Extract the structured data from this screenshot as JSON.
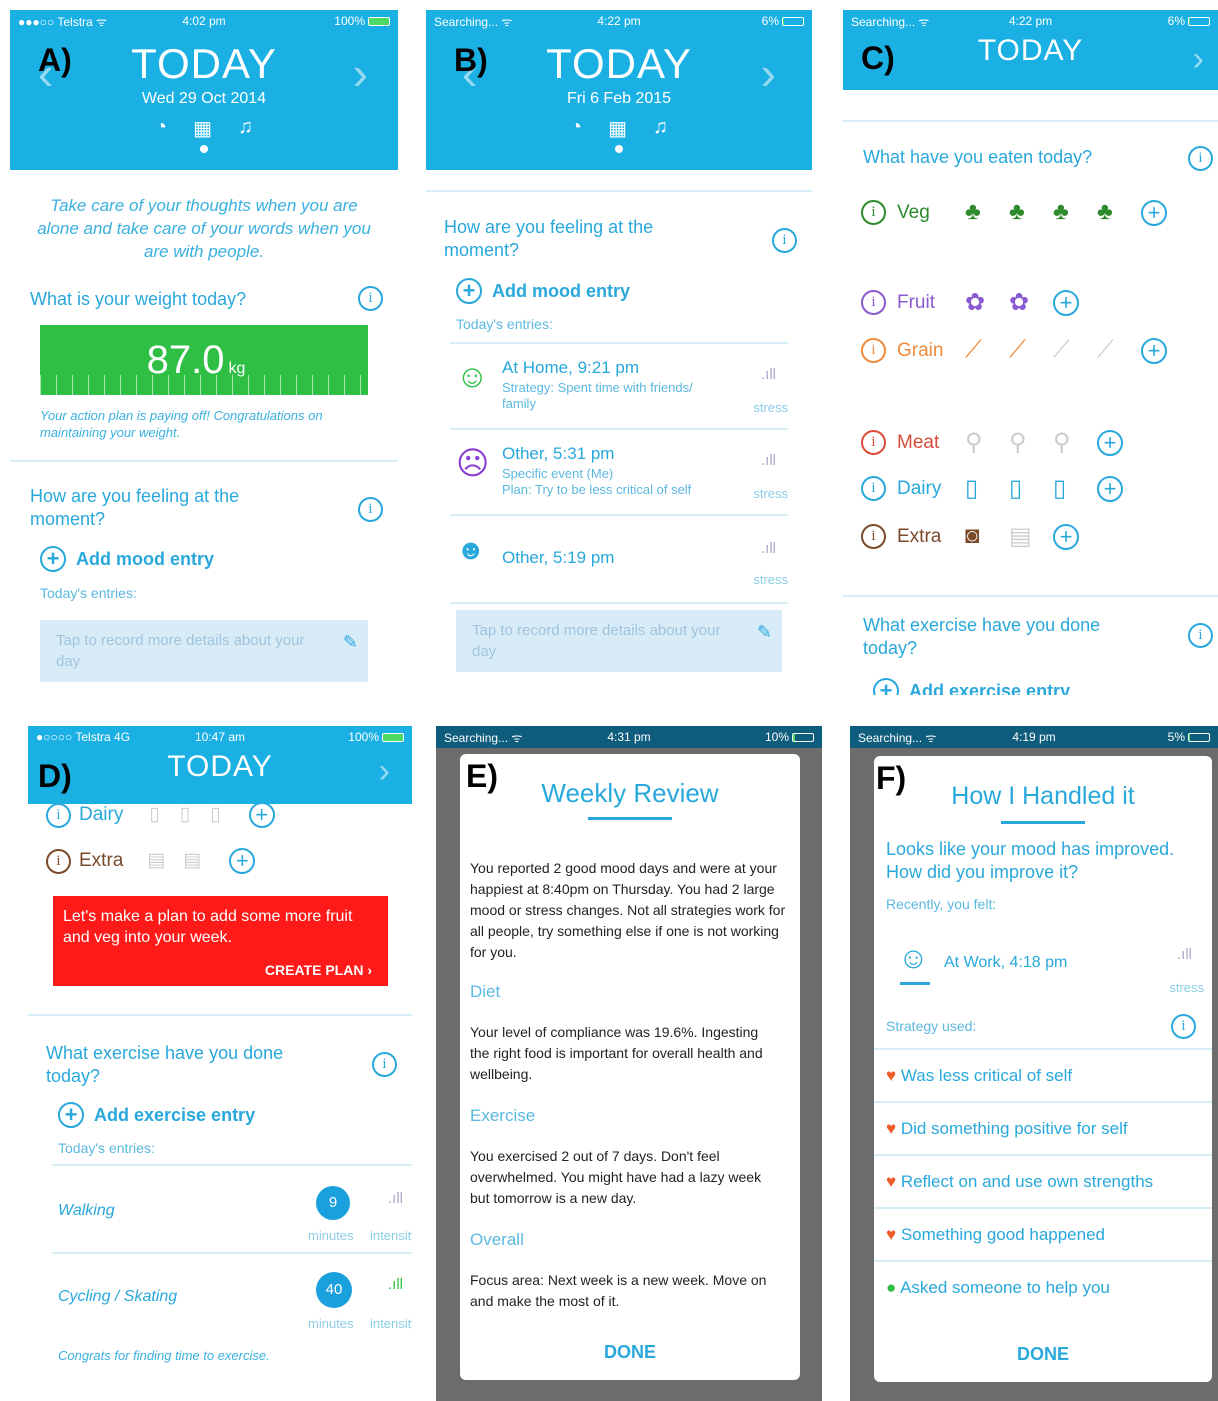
{
  "panels": {
    "a": {
      "label": "A)",
      "status": {
        "carrier": "●●●○○ Telstra ᯤ",
        "time": "4:02 pm",
        "battery": "100%"
      },
      "title": "TODAY",
      "date": "Wed 29 Oct 2014",
      "quote": "Take care of your thoughts when you are alone and take care of your words when you are with people.",
      "weight_q": "What is your weight today?",
      "weight_val": "87.0",
      "weight_unit": "kg",
      "weight_msg": "Your action plan is paying off! Congratulations on maintaining your weight.",
      "mood_q": "How are you feeling at the moment?",
      "add_mood": "Add mood entry",
      "entries": "Today's entries:",
      "tap": "Tap to record more details about your day"
    },
    "b": {
      "label": "B)",
      "status": {
        "carrier": "Searching... ᯤ",
        "time": "4:22 pm",
        "battery": "6%"
      },
      "title": "TODAY",
      "date": "Fri 6 Feb 2015",
      "mood_q": "How are you feeling at the moment?",
      "add_mood": "Add mood entry",
      "entries": "Today's entries:",
      "items": [
        {
          "title": "At Home, 9:21 pm",
          "l1": "Strategy: Spent time with friends/",
          "l2": "family",
          "stress": "stress",
          "face": "☺"
        },
        {
          "title": "Other, 5:31 pm",
          "l1": "Specific event (Me)",
          "l2": "Plan: Try to be less critical of self",
          "stress": "stress",
          "face": "☹"
        },
        {
          "title": "Other, 5:19 pm",
          "l1": "",
          "l2": "",
          "stress": "stress",
          "face": "😎"
        }
      ],
      "tap": "Tap to record more details about your day"
    },
    "c": {
      "label": "C)",
      "status": {
        "carrier": "Searching... ᯤ",
        "time": "4:22 pm",
        "battery": "6%"
      },
      "title": "TODAY",
      "eat_q": "What have you eaten today?",
      "foods": [
        {
          "name": "Veg",
          "color": "#2d8a2d"
        },
        {
          "name": "Fruit",
          "color": "#8a5bd0"
        },
        {
          "name": "Grain",
          "color": "#f08a3a"
        },
        {
          "name": "Meat",
          "color": "#d94c3a"
        },
        {
          "name": "Dairy",
          "color": "#29a8dc"
        },
        {
          "name": "Extra",
          "color": "#7a4a2a"
        }
      ],
      "ex_q": "What exercise have you done today?",
      "add_ex": "Add exercise entry"
    },
    "d": {
      "label": "D)",
      "status": {
        "carrier": "●○○○○ Telstra 4G",
        "time": "10:47 am",
        "battery": "100%"
      },
      "title": "TODAY",
      "dairy": "Dairy",
      "extra": "Extra",
      "plan_msg": "Let's make a plan to add some more fruit and veg into your week.",
      "plan_btn": "CREATE PLAN",
      "ex_q": "What exercise have you done today?",
      "add_ex": "Add exercise entry",
      "entries": "Today's entries:",
      "ex": [
        {
          "name": "Walking",
          "minutes": "9"
        },
        {
          "name": "Cycling / Skating",
          "minutes": "40"
        }
      ],
      "minutes_lbl": "minutes",
      "intensity_lbl": "intensity",
      "congrats": "Congrats for finding time to exercise."
    },
    "e": {
      "label": "E)",
      "status": {
        "carrier": "Searching... ᯤ",
        "time": "4:31 pm",
        "battery": "10%"
      },
      "title": "Weekly Review",
      "mood_text": "You reported 2 good mood days and were at your happiest at 8:40pm on Thursday. You had 2 large mood or stress changes. Not all strategies work for all people, try something else if one is not working for you.",
      "diet_h": "Diet",
      "diet_text": "Your level of compliance was 19.6%. Ingesting the right food is important for overall health and wellbeing.",
      "ex_h": "Exercise",
      "ex_text": "You exercised 2 out of 7 days. Don't feel overwhelmed. You might have had a lazy week but tomorrow is a new day.",
      "ov_h": "Overall",
      "ov_text": "Focus area: Next week is a new week. Move on and make the most of it.",
      "done": "DONE"
    },
    "f": {
      "label": "F)",
      "status": {
        "carrier": "Searching... ᯤ",
        "time": "4:19 pm",
        "battery": "5%"
      },
      "title": "How I Handled it",
      "q": "Looks like your mood has improved. How did you improve it?",
      "recent": "Recently, you felt:",
      "entry": "At Work, 4:18 pm",
      "stress": "stress",
      "strat_lbl": "Strategy used:",
      "strategies": [
        "Was less critical of self",
        "Did something positive for self",
        "Reflect on and use own strengths",
        "Something good happened",
        "Asked someone to help you"
      ],
      "done": "DONE"
    }
  }
}
